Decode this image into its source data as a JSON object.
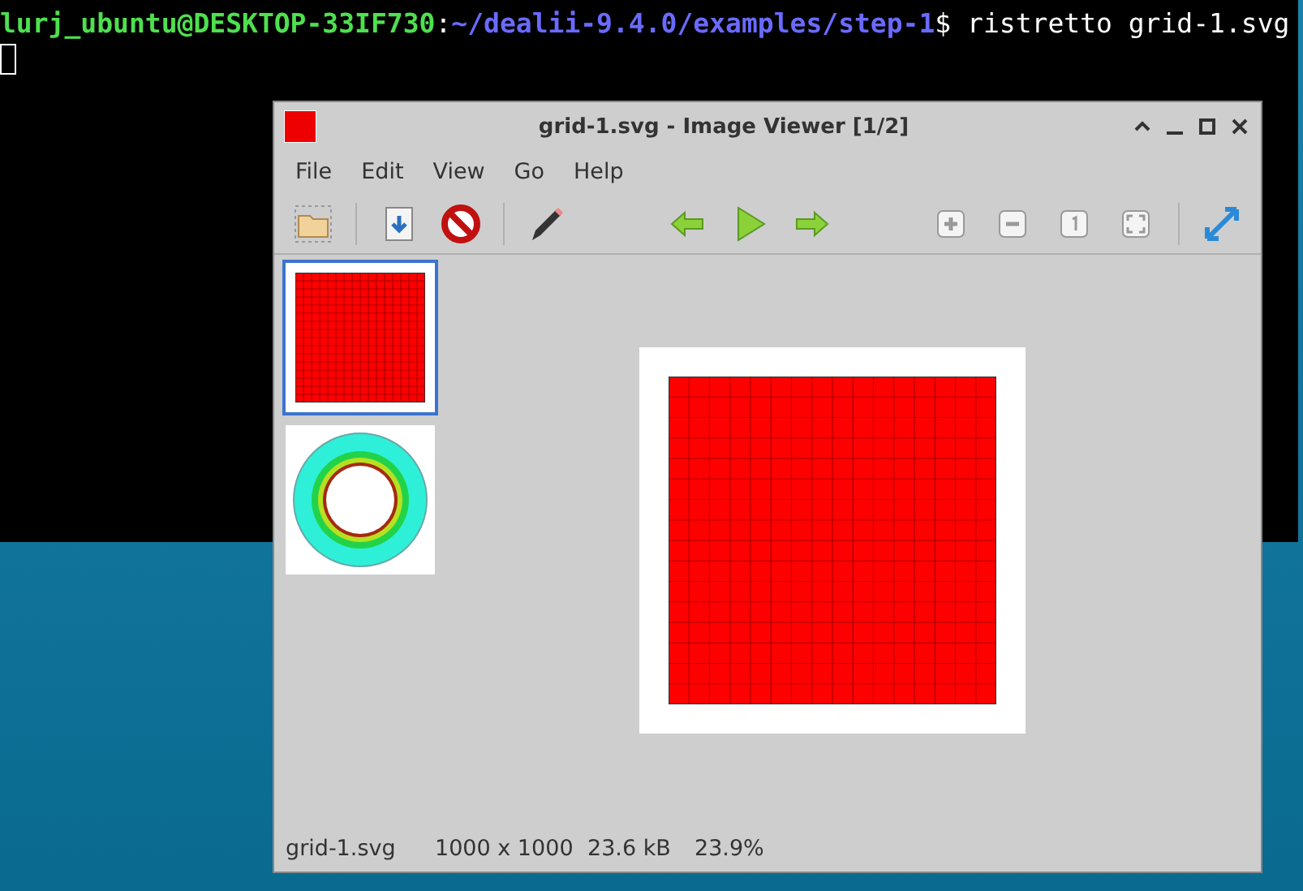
{
  "terminal": {
    "user_host": "lurj_ubuntu@DESKTOP-33IF730",
    "separator": ":",
    "path": "~/dealii-9.4.0/examples/step-1",
    "command": "$ ristretto grid-1.svg"
  },
  "window": {
    "title": "grid-1.svg - Image Viewer [1/2]"
  },
  "menu": [
    "File",
    "Edit",
    "View",
    "Go",
    "Help"
  ],
  "thumbnails": [
    {
      "kind": "grid",
      "selected": true
    },
    {
      "kind": "ring",
      "selected": false
    }
  ],
  "status_bar": [
    "grid-1.svg",
    "1000 x 1000",
    "23.6 kB",
    "23.9%"
  ]
}
